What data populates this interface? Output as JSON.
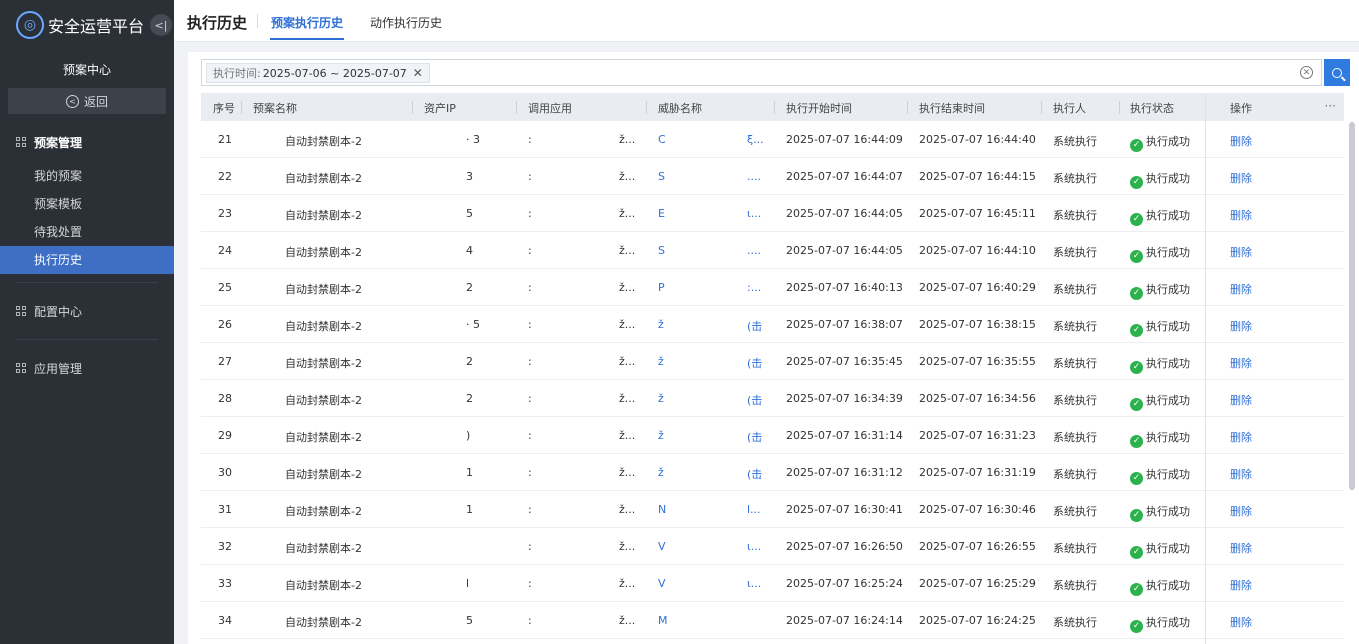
{
  "app": {
    "title": "安全运营平台",
    "collapse_icon": "collapse-left-icon"
  },
  "sidebar": {
    "section_title": "预案中心",
    "back_label": "返回",
    "groups": [
      {
        "label": "预案管理",
        "items": [
          "我的预案",
          "预案模板",
          "待我处置",
          "执行历史"
        ],
        "active_item": "执行历史"
      },
      {
        "label": "配置中心"
      },
      {
        "label": "应用管理"
      }
    ]
  },
  "topbar": {
    "title": "执行历史",
    "tabs": [
      {
        "label": "预案执行历史",
        "active": true
      },
      {
        "label": "动作执行历史",
        "active": false
      }
    ]
  },
  "filter": {
    "tag_key": "执行时间:",
    "tag_value": "2025-07-06 ~ 2025-07-07",
    "close": "✕"
  },
  "table": {
    "headers": [
      "序号",
      "预案名称",
      "资产IP",
      "调用应用",
      "威胁名称",
      "执行开始时间",
      "执行结束时间",
      "执行人",
      "执行状态",
      "操作"
    ],
    "rows": [
      {
        "no": "21",
        "name": "自动封禁剧本-2",
        "ip": "·  3",
        "app": ":",
        "app2": "ž...",
        "threat": "C",
        "threat2": "ξ...",
        "start": "2025-07-07 16:44:09",
        "end": "2025-07-07 16:44:40",
        "executor": "系统执行",
        "status": "执行成功",
        "op": "删除"
      },
      {
        "no": "22",
        "name": "自动封禁剧本-2",
        "ip": "3",
        "app": ":",
        "app2": "ž...",
        "threat": "S",
        "threat2": "....",
        "start": "2025-07-07 16:44:07",
        "end": "2025-07-07 16:44:15",
        "executor": "系统执行",
        "status": "执行成功",
        "op": "删除"
      },
      {
        "no": "23",
        "name": "自动封禁剧本-2",
        "ip": "5",
        "app": ":",
        "app2": "ž...",
        "threat": "E",
        "threat2": "ι...",
        "start": "2025-07-07 16:44:05",
        "end": "2025-07-07 16:45:11",
        "executor": "系统执行",
        "status": "执行成功",
        "op": "删除"
      },
      {
        "no": "24",
        "name": "自动封禁剧本-2",
        "ip": "4",
        "app": ":",
        "app2": "ž...",
        "threat": "S",
        "threat2": "....",
        "start": "2025-07-07 16:44:05",
        "end": "2025-07-07 16:44:10",
        "executor": "系统执行",
        "status": "执行成功",
        "op": "删除"
      },
      {
        "no": "25",
        "name": "自动封禁剧本-2",
        "ip": "2",
        "app": ":",
        "app2": "ž...",
        "threat": "P",
        "threat2": ":...",
        "start": "2025-07-07 16:40:13",
        "end": "2025-07-07 16:40:29",
        "executor": "系统执行",
        "status": "执行成功",
        "op": "删除"
      },
      {
        "no": "26",
        "name": "自动封禁剧本-2",
        "ip": "·  5",
        "app": ":",
        "app2": "ž...",
        "threat": "ž",
        "threat2": "(击",
        "start": "2025-07-07 16:38:07",
        "end": "2025-07-07 16:38:15",
        "executor": "系统执行",
        "status": "执行成功",
        "op": "删除"
      },
      {
        "no": "27",
        "name": "自动封禁剧本-2",
        "ip": "2",
        "app": ":",
        "app2": "ž...",
        "threat": "ž",
        "threat2": "(击",
        "start": "2025-07-07 16:35:45",
        "end": "2025-07-07 16:35:55",
        "executor": "系统执行",
        "status": "执行成功",
        "op": "删除"
      },
      {
        "no": "28",
        "name": "自动封禁剧本-2",
        "ip": "2",
        "app": ":",
        "app2": "ž...",
        "threat": "ž",
        "threat2": "(击",
        "start": "2025-07-07 16:34:39",
        "end": "2025-07-07 16:34:56",
        "executor": "系统执行",
        "status": "执行成功",
        "op": "删除"
      },
      {
        "no": "29",
        "name": "自动封禁剧本-2",
        "ip": ")",
        "app": ":",
        "app2": "ž...",
        "threat": "ž",
        "threat2": "(击",
        "start": "2025-07-07 16:31:14",
        "end": "2025-07-07 16:31:23",
        "executor": "系统执行",
        "status": "执行成功",
        "op": "删除"
      },
      {
        "no": "30",
        "name": "自动封禁剧本-2",
        "ip": "1",
        "app": ":",
        "app2": "ž...",
        "threat": "ž",
        "threat2": "(击",
        "start": "2025-07-07 16:31:12",
        "end": "2025-07-07 16:31:19",
        "executor": "系统执行",
        "status": "执行成功",
        "op": "删除"
      },
      {
        "no": "31",
        "name": "自动封禁剧本-2",
        "ip": "1",
        "app": ":",
        "app2": "ž...",
        "threat": "N",
        "threat2": "l...",
        "start": "2025-07-07 16:30:41",
        "end": "2025-07-07 16:30:46",
        "executor": "系统执行",
        "status": "执行成功",
        "op": "删除"
      },
      {
        "no": "32",
        "name": "自动封禁剧本-2",
        "ip": "",
        "app": ":",
        "app2": "ž...",
        "threat": "V",
        "threat2": "ι...",
        "start": "2025-07-07 16:26:50",
        "end": "2025-07-07 16:26:55",
        "executor": "系统执行",
        "status": "执行成功",
        "op": "删除"
      },
      {
        "no": "33",
        "name": "自动封禁剧本-2",
        "ip": "l",
        "app": ":",
        "app2": "ž...",
        "threat": "V",
        "threat2": "ι...",
        "start": "2025-07-07 16:25:24",
        "end": "2025-07-07 16:25:29",
        "executor": "系统执行",
        "status": "执行成功",
        "op": "删除"
      },
      {
        "no": "34",
        "name": "自动封禁剧本-2",
        "ip": "5",
        "app": ":",
        "app2": "ž...",
        "threat": "M",
        "threat2": "",
        "start": "2025-07-07 16:24:14",
        "end": "2025-07-07 16:24:25",
        "executor": "系统执行",
        "status": "执行成功",
        "op": "删除"
      }
    ]
  },
  "colors": {
    "accent": "#2f6fd6",
    "sidebar_bg": "#2b2f36",
    "success": "#2bb24c"
  }
}
